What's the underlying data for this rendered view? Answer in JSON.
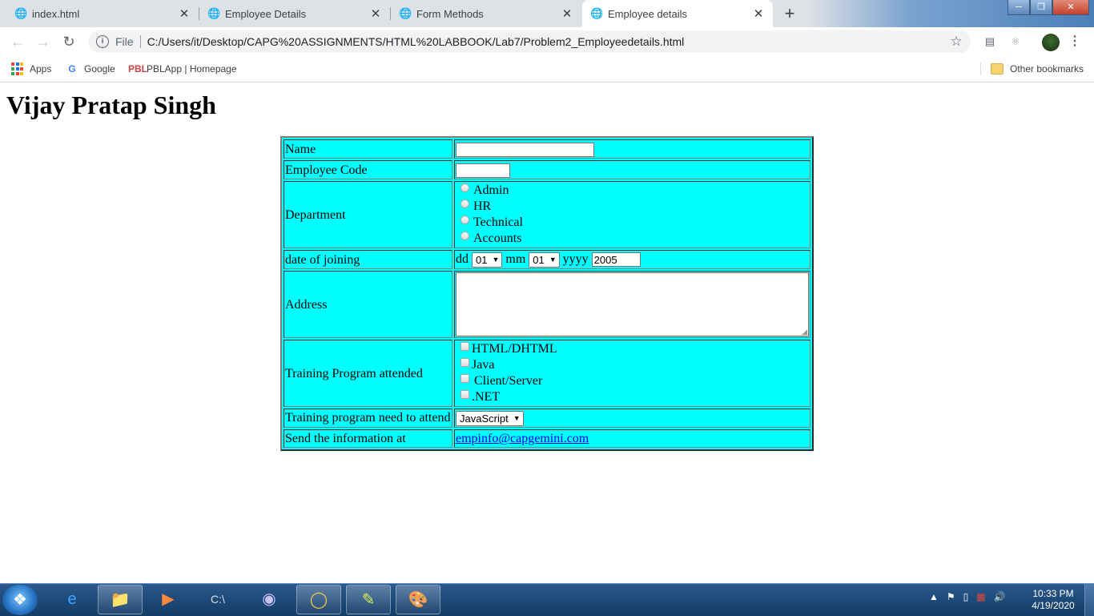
{
  "browser": {
    "tabs": [
      {
        "label": "index.html",
        "active": false
      },
      {
        "label": "Employee Details",
        "active": false
      },
      {
        "label": "Form Methods",
        "active": false
      },
      {
        "label": "Employee details",
        "active": true
      }
    ],
    "address": {
      "scheme": "File",
      "url": "C:/Users/it/Desktop/CAPG%20ASSIGNMENTS/HTML%20LABBOOK/Lab7/Problem2_Employeedetails.html"
    },
    "bookmarks": {
      "apps": "Apps",
      "google": "Google",
      "pblapp": "PBLApp | Homepage",
      "other": "Other bookmarks"
    }
  },
  "page": {
    "heading": "Vijay Pratap Singh",
    "form": {
      "name_label": "Name",
      "name_value": "",
      "code_label": "Employee Code",
      "code_value": "",
      "department_label": "Department",
      "departments": [
        "Admin",
        "HR",
        "Technical",
        "Accounts"
      ],
      "doj_label": "date of joining",
      "dd_label": "dd",
      "dd_value": "01",
      "mm_label": "mm",
      "mm_value": "01",
      "yyyy_label": "yyyy",
      "yyyy_value": "2005",
      "address_label": "Address",
      "address_value": "",
      "training_attended_label": "Training Program attended",
      "trainings": [
        "HTML/DHTML",
        "Java",
        "Client/Server",
        ".NET"
      ],
      "training_need_label": "Training program need to attend",
      "training_need_value": "JavaScript",
      "send_label": "Send the information at",
      "email": "empinfo@capgemini.com"
    },
    "colors": {
      "table_background": "#00ffff",
      "link": "#0000ee"
    }
  },
  "taskbar": {
    "time": "10:33 PM",
    "date": "4/19/2020"
  }
}
